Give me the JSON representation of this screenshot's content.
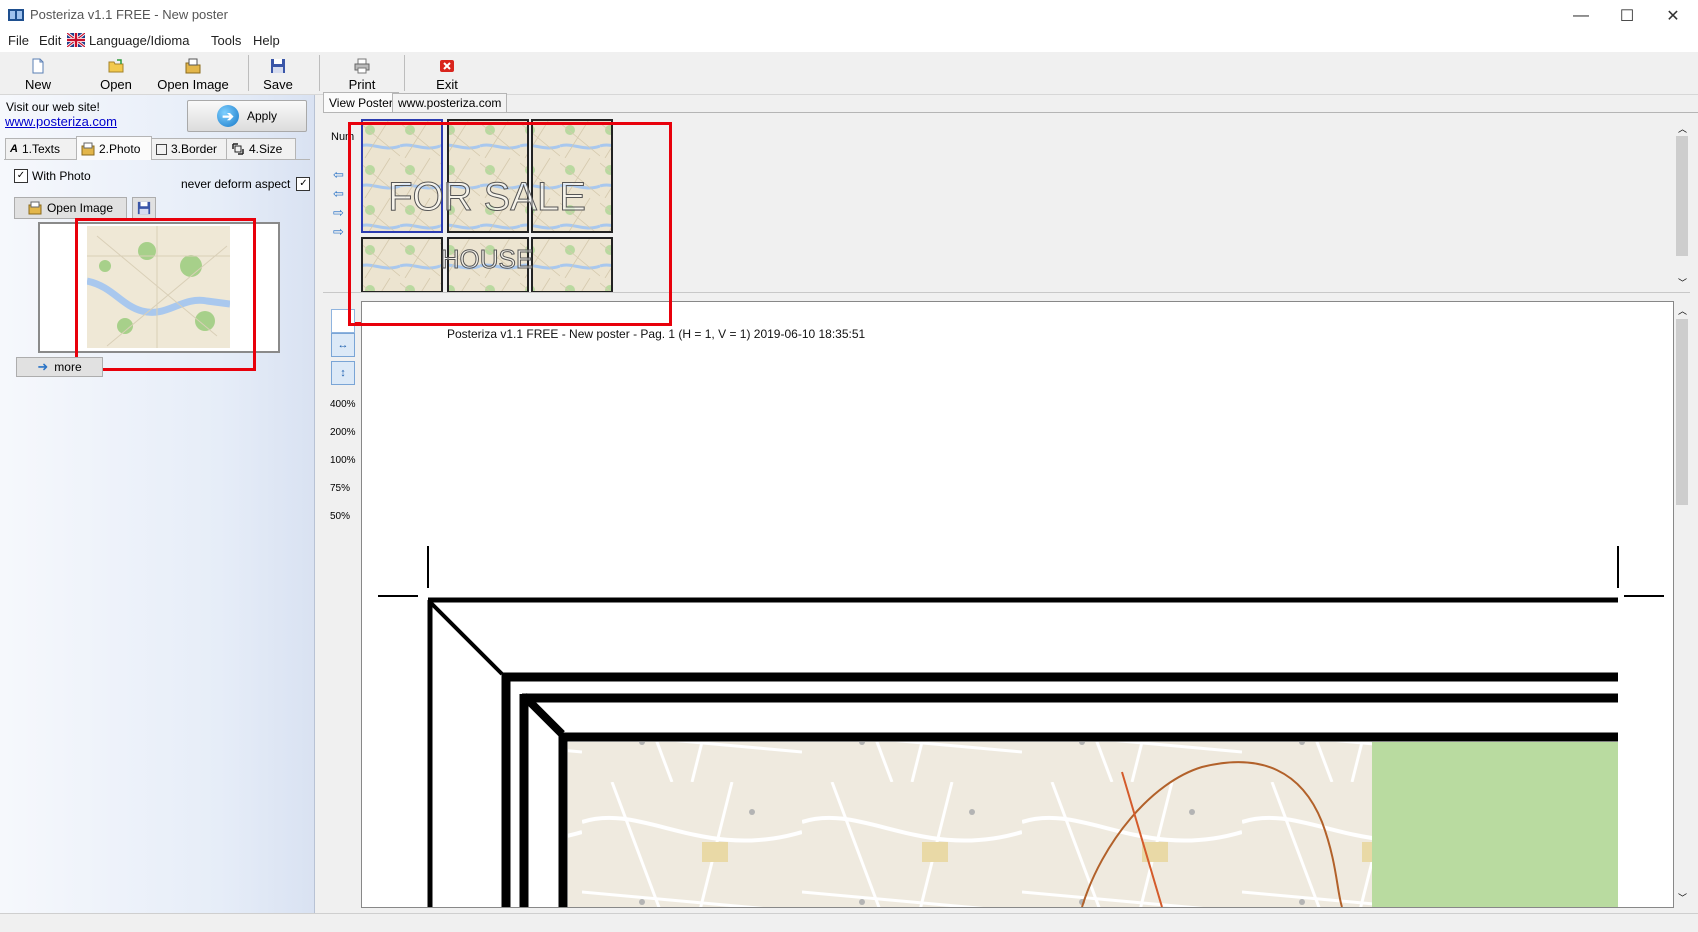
{
  "window": {
    "title": "Posteriza v1.1 FREE - New poster",
    "controls": [
      "—",
      "☐",
      "✕"
    ]
  },
  "menu": [
    "File",
    "Edit",
    "Language/Idioma",
    "Tools",
    "Help"
  ],
  "toolbar": {
    "new": "New",
    "open": "Open",
    "open_image": "Open Image",
    "save": "Save",
    "print": "Print",
    "exit": "Exit"
  },
  "left_panel": {
    "visit_label": "Visit our web site!",
    "site_link": "www.posteriza.com",
    "apply_label": "Apply",
    "tabs": [
      {
        "label": "1.Texts",
        "icon": "font-icon"
      },
      {
        "label": "2.Photo",
        "icon": "photo-icon"
      },
      {
        "label": "3.Border",
        "icon": "border-icon"
      },
      {
        "label": "4.Size",
        "icon": "resize-icon"
      }
    ],
    "active_tab": "2.Photo",
    "with_photo_label": "With Photo",
    "with_photo_checked": true,
    "never_deform_label": "never deform aspect",
    "never_deform_checked": true,
    "open_image_label": "Open Image",
    "more_label": "more"
  },
  "right_panel": {
    "tabs": [
      "View Poster",
      "www.posteriza.com"
    ],
    "active_tab": "View Poster",
    "num_label": "Num",
    "thumb_overlay_line1": "FOR SALE",
    "thumb_overlay_line2": "HOUSE",
    "zoom_levels": [
      "400%",
      "200%",
      "100%",
      "75%",
      "50%"
    ],
    "page_header": "Posteriza v1.1 FREE - New poster - Pag. 1 (H = 1, V = 1) 2019-06-10   18:35:51"
  },
  "colors": {
    "highlight_red": "#e8000b",
    "link_blue": "#0000cc",
    "map_green": "#a7d08a",
    "map_river": "#a9c8ee"
  }
}
